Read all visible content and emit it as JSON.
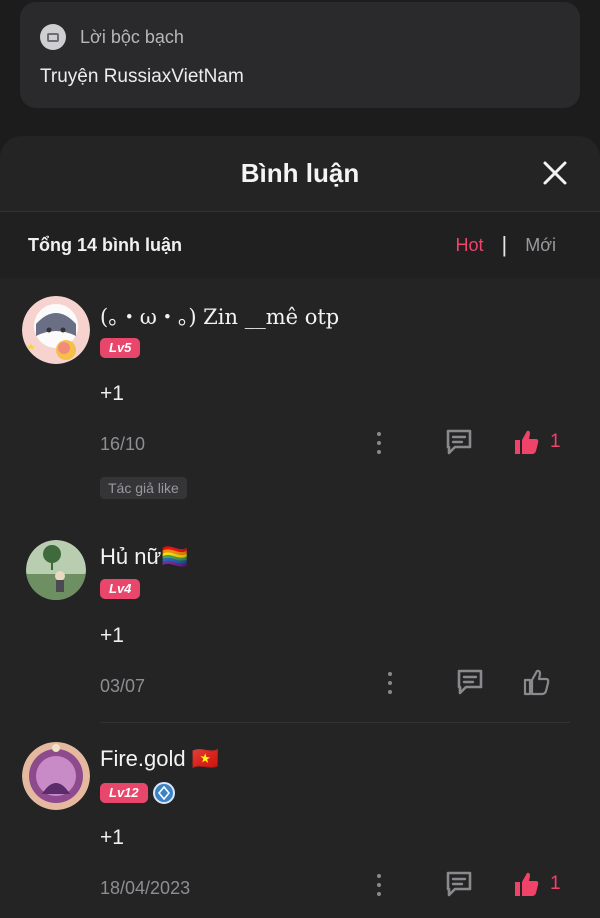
{
  "top_card": {
    "label": "Lời bộc bạch",
    "story_title": "Truyện RussiaxVietNam"
  },
  "sheet": {
    "title": "Bình luận"
  },
  "summary": {
    "total": "Tổng 14 bình luận",
    "sort_hot": "Hot",
    "sort_new": "Mới"
  },
  "comments": [
    {
      "username": "(。・ω・。) Zin __mê otp",
      "level": "Lv5",
      "text": "+1",
      "date": "16/10",
      "likes": "1",
      "liked": true,
      "author_like": "Tác giả like"
    },
    {
      "username": "Hủ nữ🏳️‍🌈",
      "level": "Lv4",
      "text": "+1",
      "date": "03/07",
      "likes": "",
      "liked": false
    },
    {
      "username": "Fire.gold 🇻🇳",
      "level": "Lv12",
      "text": "+1",
      "date": "18/04/2023",
      "likes": "1",
      "liked": true
    }
  ],
  "colors": {
    "accent": "#f0436a",
    "background": "#242425",
    "level_badge": "#e8466a"
  }
}
